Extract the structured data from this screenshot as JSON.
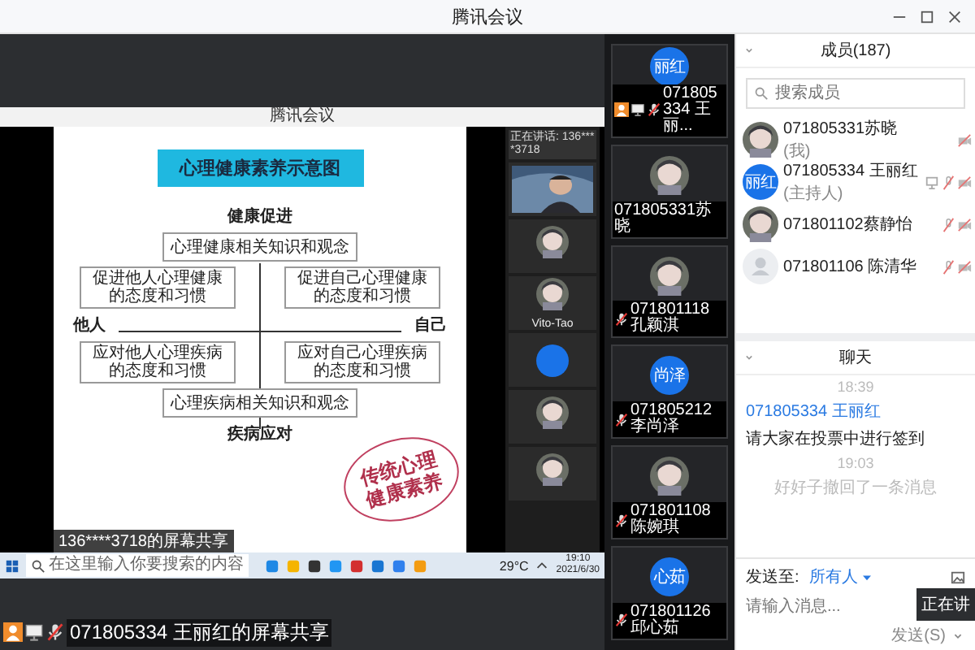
{
  "window": {
    "title": "腾讯会议"
  },
  "share": {
    "inner_title": "腾讯会议",
    "slide": {
      "title": "心理健康素养示意图",
      "top_label": "健康促进",
      "top_box": "心理健康相关知识和观念",
      "left_axis": "他人",
      "right_axis": "自己",
      "quadrants": [
        "促进他人心理健康的态度和习惯",
        "促进自己心理健康的态度和习惯",
        "应对他人心理疾病的态度和习惯",
        "应对自己心理疾病的态度和习惯"
      ],
      "bottom_box": "心理疾病相关知识和观念",
      "bottom_label": "疾病应对",
      "stamp_lines": [
        "传统心理",
        "健康素养"
      ]
    },
    "presenter_label": "136****3718的屏幕共享",
    "speaking_label": "正在讲话: 136****3718",
    "thumbnails": [
      {
        "kind": "video"
      },
      {
        "kind": "picture"
      },
      {
        "kind": "picture",
        "name": "Vito-Tao"
      },
      {
        "kind": "initials"
      },
      {
        "kind": "picture"
      },
      {
        "kind": "picture"
      }
    ],
    "taskbar": {
      "search_placeholder": "在这里输入你要搜索的内容",
      "temperature": "29°C",
      "time": "19:10",
      "date": "2021/6/30"
    }
  },
  "share_label": "071805334 王丽红的屏幕共享",
  "video_tiles": [
    {
      "avatar": {
        "kind": "initials",
        "text": "丽红"
      },
      "name": "071805334 王丽...",
      "host": true,
      "sharing": true,
      "mic_muted": true
    },
    {
      "avatar": {
        "kind": "picture"
      },
      "name": "071805331苏晓",
      "host": false,
      "sharing": false,
      "mic_muted": false
    },
    {
      "avatar": {
        "kind": "picture"
      },
      "name": "071801118孔颖淇",
      "host": false,
      "sharing": false,
      "mic_muted": true
    },
    {
      "avatar": {
        "kind": "initials",
        "text": "尚泽"
      },
      "name": "071805212 李尚泽",
      "host": false,
      "sharing": false,
      "mic_muted": true
    },
    {
      "avatar": {
        "kind": "picture"
      },
      "name": "071801108陈婉琪",
      "host": false,
      "sharing": false,
      "mic_muted": true
    },
    {
      "avatar": {
        "kind": "initials",
        "text": "心茹"
      },
      "name": "071801126邱心茹",
      "host": false,
      "sharing": false,
      "mic_muted": true
    }
  ],
  "members": {
    "title": "成员(187)",
    "search": {
      "placeholder": "搜索成员"
    },
    "items": [
      {
        "name": "071805331苏晓",
        "role": "(我)",
        "avatar": {
          "kind": "picture"
        },
        "sharing": false,
        "mic_muted": false,
        "camera_off": true
      },
      {
        "name": "071805334 王丽红",
        "role": "(主持人)",
        "avatar": {
          "kind": "initials",
          "text": "丽红"
        },
        "sharing": true,
        "mic_muted": true,
        "camera_off": true
      },
      {
        "name": "071801102蔡静怡",
        "avatar": {
          "kind": "picture"
        },
        "sharing": false,
        "mic_muted": true,
        "camera_off": true
      },
      {
        "name": "071801106 陈清华",
        "avatar": {
          "kind": "default"
        },
        "sharing": false,
        "mic_muted": true,
        "camera_off": true
      }
    ]
  },
  "chat": {
    "title": "聊天",
    "messages": [
      {
        "kind": "time",
        "text": "18:39"
      },
      {
        "kind": "message",
        "sender": "071805334 王丽红",
        "text": "请大家在投票中进行签到"
      },
      {
        "kind": "time",
        "text": "19:03"
      },
      {
        "kind": "notice",
        "text": "好好子撤回了一条消息"
      }
    ],
    "send_to_label": "发送至:",
    "recipient": "所有人",
    "input": {
      "placeholder": "请输入消息..."
    },
    "send_button": "发送(S)",
    "tooltip": "正在讲"
  }
}
